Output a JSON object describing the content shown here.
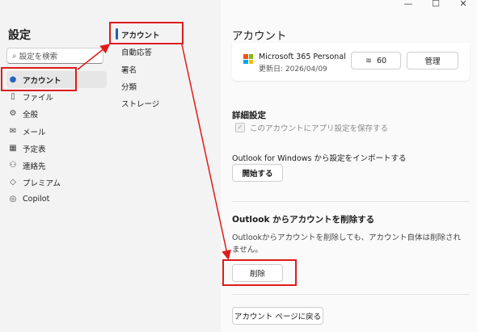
{
  "window": {
    "minimize": "—",
    "maximize": "☐",
    "close": "✕"
  },
  "sidebar": {
    "title": "設定",
    "search_placeholder": "設定を検索",
    "items": [
      {
        "label": "アカウント",
        "icon": "person-icon",
        "active": true
      },
      {
        "label": "ファイル",
        "icon": "file-icon"
      },
      {
        "label": "全般",
        "icon": "gear-icon"
      },
      {
        "label": "メール",
        "icon": "mail-icon"
      },
      {
        "label": "予定表",
        "icon": "calendar-icon"
      },
      {
        "label": "連絡先",
        "icon": "people-icon"
      },
      {
        "label": "プレミアム",
        "icon": "diamond-icon"
      },
      {
        "label": "Copilot",
        "icon": "copilot-icon"
      }
    ]
  },
  "subnav": {
    "items": [
      {
        "label": "アカウント",
        "active": true
      },
      {
        "label": "自動応答"
      },
      {
        "label": "署名"
      },
      {
        "label": "分類"
      },
      {
        "label": "ストレージ"
      }
    ]
  },
  "main": {
    "title": "アカウント",
    "subscription": {
      "product": "Microsoft 365 Personal",
      "renewal": "更新日: 2026/04/09",
      "storage_count": "60",
      "manage_label": "管理"
    },
    "advanced": {
      "title": "詳細設定",
      "save_settings_label": "このアカウントにアプリ設定を保存する",
      "import_label": "Outlook for Windows から設定をインポートする",
      "start_label": "開始する"
    },
    "remove": {
      "title": "Outlook からアカウントを削除する",
      "description": "Outlookからアカウントを削除しても、アカウント自体は削除されません。",
      "delete_label": "削除"
    },
    "back_label": "アカウント ページに戻る"
  },
  "colors": {
    "annotation": "#e01b1b",
    "accent": "#1f5fa8"
  }
}
